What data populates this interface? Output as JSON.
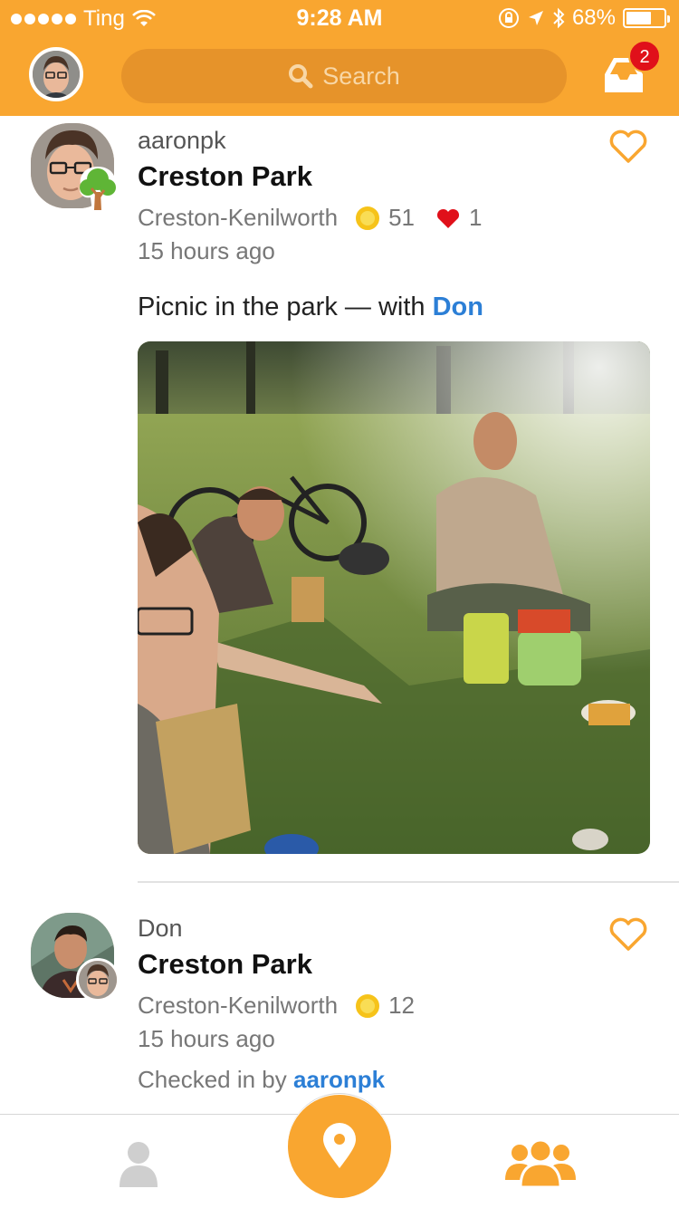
{
  "status_bar": {
    "carrier": "Ting",
    "time": "9:28 AM",
    "battery": "68%",
    "battery_level": 0.68
  },
  "header": {
    "search_placeholder": "Search",
    "notification_count": "2"
  },
  "feed": [
    {
      "username": "aaronpk",
      "venue": "Creston Park",
      "neighborhood": "Creston-Kenilworth",
      "coins": "51",
      "likes": "1",
      "time_ago": "15 hours ago",
      "shout_prefix": "Picnic in the park — with ",
      "shout_with": "Don",
      "sticker": "tree-sticker-icon"
    },
    {
      "username": "Don",
      "venue": "Creston Park",
      "neighborhood": "Creston-Kenilworth",
      "coins": "12",
      "time_ago": "15 hours ago",
      "checked_in_prefix": "Checked in by ",
      "checked_in_by": "aaronpk"
    }
  ],
  "colors": {
    "brand": "#f9a630",
    "search_bg": "#e6932a",
    "link": "#2c7fd6",
    "badge": "#e0101a",
    "like": "#e0101a",
    "coin": "#f6c31a"
  },
  "tabbar": {
    "items": [
      "profile-tab",
      "check-in-tab",
      "friends-tab"
    ],
    "active": "friends-tab"
  }
}
